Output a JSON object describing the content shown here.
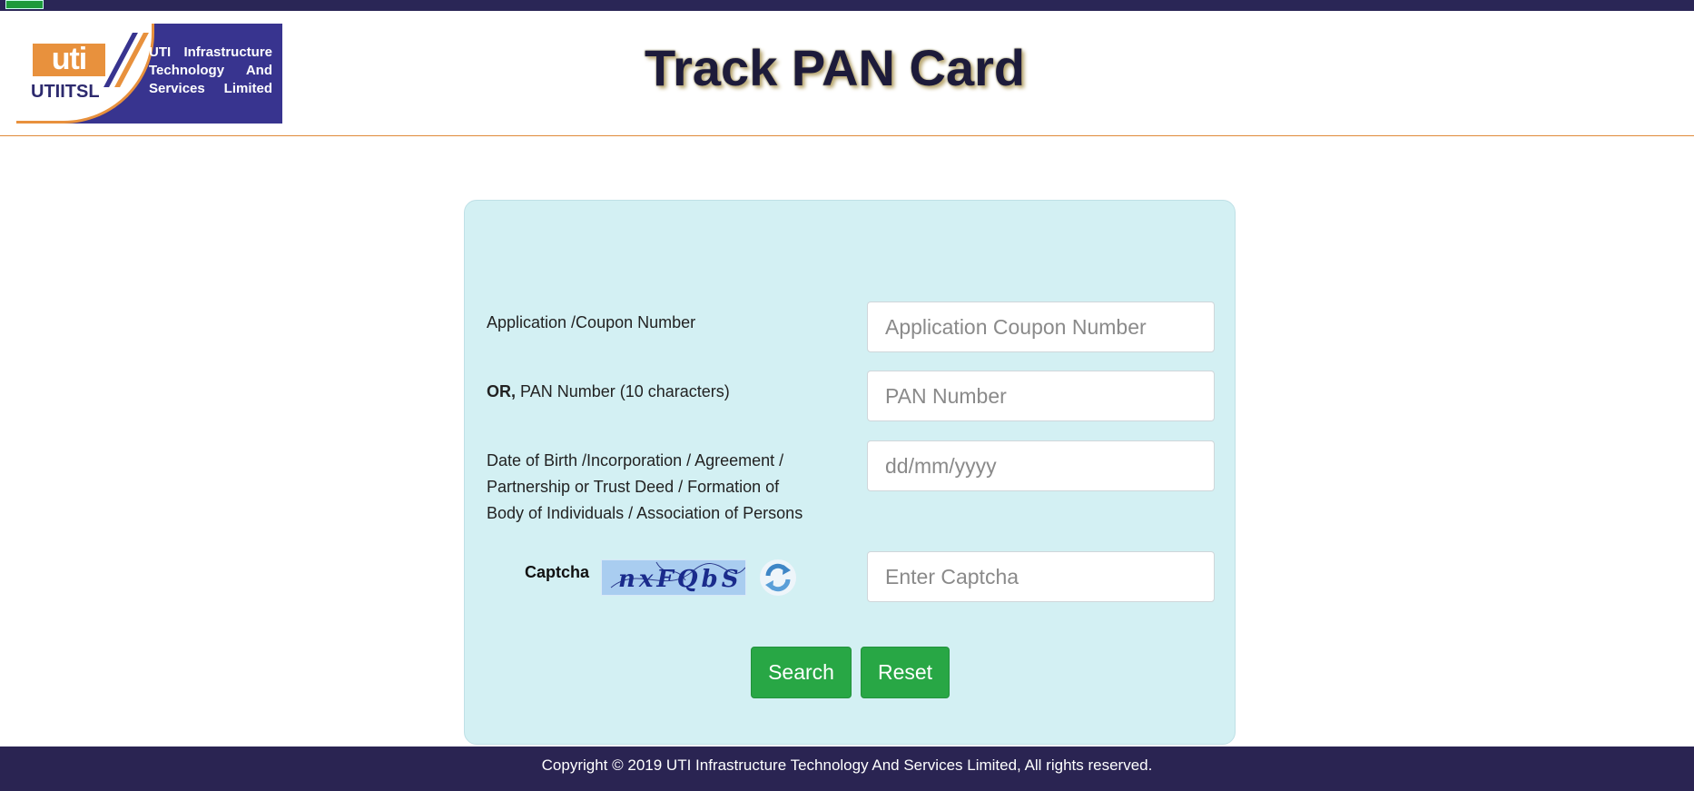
{
  "header": {
    "logo": {
      "uti_word": "uti",
      "abbreviation": "UTIITSL",
      "company_line1": "UTI Infrastructure",
      "company_line2": "Technology And",
      "company_line3": "Services Limited"
    },
    "title": "Track PAN Card"
  },
  "form": {
    "application_label": "Application /Coupon Number",
    "application_placeholder": "Application Coupon Number",
    "pan_label_prefix": "OR,",
    "pan_label": "PAN Number (10 characters)",
    "pan_placeholder": "PAN Number",
    "dob_label_line1": "Date of Birth /Incorporation / Agreement /",
    "dob_label_line2": "Partnership or Trust Deed / Formation of",
    "dob_label_line3": "Body of Individuals / Association of Persons",
    "dob_placeholder": "dd/mm/yyyy",
    "captcha_label": "Captcha",
    "captcha_text": "nxFQbS",
    "captcha_placeholder": "Enter Captcha",
    "search_label": "Search",
    "reset_label": "Reset"
  },
  "icons": {
    "refresh": "refresh-icon"
  },
  "colors": {
    "brand_navy": "#38348f",
    "brand_orange": "#e8913d",
    "panel_bg": "#d3f0f3",
    "button_green": "#28a745",
    "footer_bg": "#2a2452"
  },
  "footer": {
    "copyright": "Copyright © 2019 UTI Infrastructure Technology And Services Limited, All rights reserved."
  }
}
